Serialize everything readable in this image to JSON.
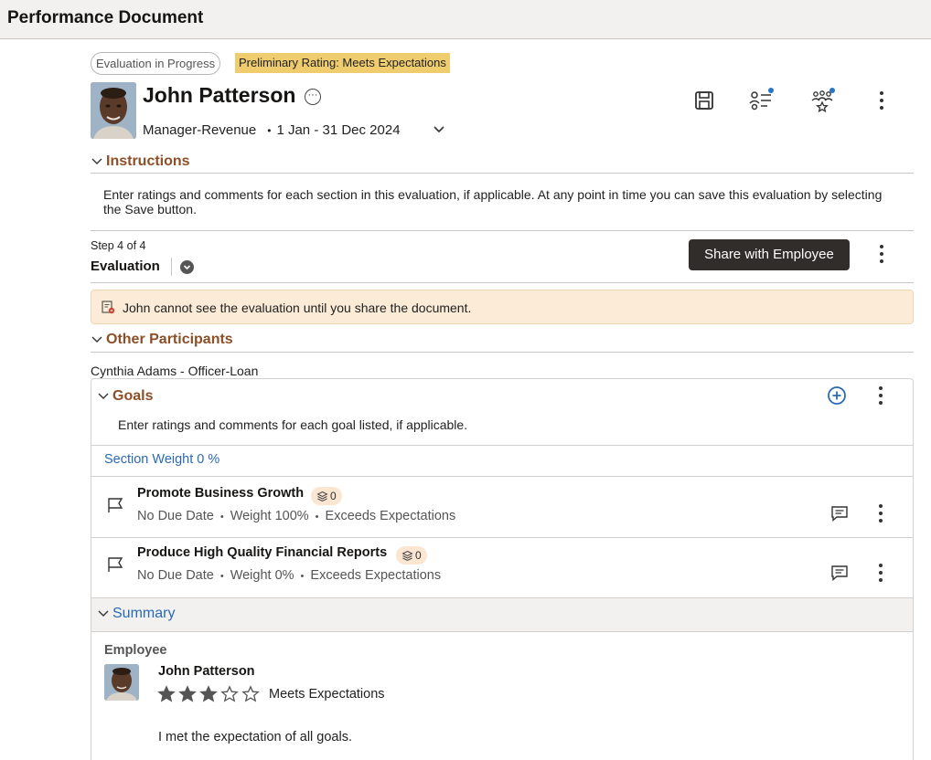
{
  "app": {
    "title": "Performance Document"
  },
  "header": {
    "status_pill": "Evaluation in Progress",
    "rating_pill": "Preliminary Rating: Meets Expectations",
    "person_name": "John Patterson",
    "job_title": "Manager-Revenue",
    "period": "1 Jan - 31 Dec 2024",
    "actions": [
      {
        "icon": "save-icon"
      },
      {
        "icon": "checklist-icon"
      },
      {
        "icon": "team-rating-icon"
      },
      {
        "icon": "more-icon"
      }
    ]
  },
  "instructions": {
    "title": "Instructions",
    "text": "Enter ratings and comments for each section in this evaluation, if applicable. At any point in time you can save this evaluation by selecting the Save button."
  },
  "step": {
    "label": "Step 4 of 4",
    "name": "Evaluation",
    "share_button": "Share with Employee"
  },
  "notice": {
    "text": "John cannot see the evaluation until you share the document."
  },
  "other_participants": {
    "title": "Other Participants",
    "participant": "Cynthia Adams - Officer-Loan"
  },
  "goals": {
    "title": "Goals",
    "description": "Enter ratings and comments for each goal listed, if applicable.",
    "section_weight": "Section Weight 0 %",
    "items": [
      {
        "title": "Promote Business Growth",
        "count": "0",
        "due": "No Due Date",
        "weight": "Weight 100%",
        "rating": "Exceeds Expectations"
      },
      {
        "title": "Produce High Quality Financial Reports",
        "count": "0",
        "due": "No Due Date",
        "weight": "Weight 0%",
        "rating": "Exceeds Expectations"
      }
    ]
  },
  "summary": {
    "title": "Summary",
    "role_label": "Employee",
    "name": "John Patterson",
    "stars": 3,
    "stars_max": 5,
    "rating": "Meets Expectations",
    "comment": "I met the expectation of all goals."
  },
  "colors": {
    "section_title": "#8d4f27",
    "link": "#2a6ab5",
    "rating_pill": "#efcc6e",
    "notice_bg": "#fcebd6",
    "primary_button": "#312d2a"
  }
}
